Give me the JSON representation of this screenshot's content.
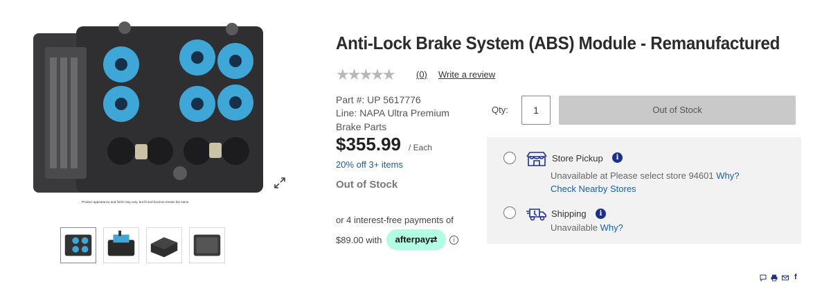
{
  "product": {
    "title": "Anti-Lock Brake System (ABS) Module - Remanufactured",
    "rating_stars": "★★★★★",
    "review_count": "(0)",
    "write_review": "Write a review",
    "part_number": "Part #: UP 5617776",
    "line_1": "Line: NAPA Ultra Premium",
    "line_2": "Brake Parts",
    "price": "$355.99",
    "price_unit": "/ Each",
    "promo": "20% off 3+ items",
    "stock_status": "Out of Stock",
    "image_caption": "Product appearance and finish may vary, but fit and function remain the same."
  },
  "payment": {
    "line_1": "or 4 interest-free payments of",
    "amount_text": "$89.00 with",
    "provider": "afterpay",
    "info": "i"
  },
  "purchase": {
    "qty_label": "Qty:",
    "qty_value": "1",
    "button_label": "Out of Stock"
  },
  "fulfillment": {
    "pickup": {
      "label": "Store Pickup",
      "status": "Unavailable at Please select store 94601",
      "why": "Why?",
      "check_stores": "Check Nearby Stores"
    },
    "shipping": {
      "label": "Shipping",
      "status": "Unavailable",
      "why": "Why?"
    },
    "info_glyph": "i"
  },
  "share": {
    "icons": [
      "chat-icon",
      "print-icon",
      "email-icon",
      "facebook-icon"
    ],
    "facebook": "f"
  },
  "colors": {
    "link": "#1a5fa8",
    "info_circle": "#1c2f8c",
    "afterpay": "#b2fce4",
    "disabled_button": "#c9c9c9",
    "panel_bg": "#f2f2f2"
  }
}
